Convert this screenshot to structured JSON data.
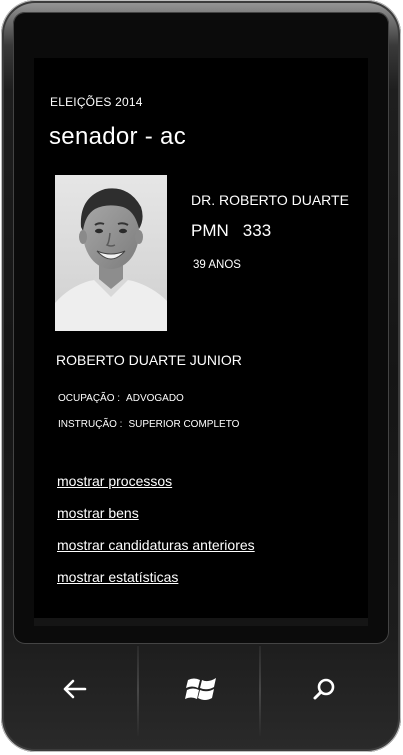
{
  "header": {
    "overline": "ELEIÇÕES 2014",
    "title": "senador - ac"
  },
  "candidate": {
    "short_name": "DR. ROBERTO DUARTE",
    "party": "PMN",
    "number": "333",
    "age": "39 ANOS",
    "full_name": "ROBERTO DUARTE JUNIOR",
    "occupation_label": "OCUPAÇÃO :",
    "occupation": "ADVOGADO",
    "education_label": "INSTRUÇÃO :",
    "education": "SUPERIOR COMPLETO"
  },
  "links": [
    {
      "label": "mostrar processos"
    },
    {
      "label": "mostrar bens"
    },
    {
      "label": "mostrar candidaturas anteriores"
    },
    {
      "label": "mostrar estatísticas"
    }
  ],
  "hardware_buttons": {
    "back": "back-arrow-icon",
    "start": "windows-logo-icon",
    "search": "search-icon"
  },
  "colors": {
    "screen_background": "#000000",
    "text": "#ffffff",
    "phone_body": "#1a1a1a"
  }
}
